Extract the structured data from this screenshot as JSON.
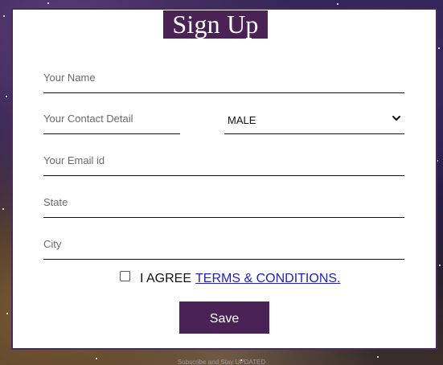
{
  "form": {
    "title": "Sign Up",
    "fields": {
      "name": {
        "placeholder": "Your Name",
        "value": ""
      },
      "contact": {
        "placeholder": "Your Contact Detail",
        "value": ""
      },
      "email": {
        "placeholder": "Your Email id",
        "value": ""
      },
      "state": {
        "placeholder": "State",
        "value": ""
      },
      "city": {
        "placeholder": "City",
        "value": ""
      }
    },
    "gender_select": {
      "selected": "MALE"
    },
    "agreement": {
      "checked": false,
      "label": "I AGREE",
      "link_text": "TERMS & CONDITIONS."
    },
    "save_label": "Save"
  },
  "footer": {
    "text": "Subscribe and Stay UPDATED"
  },
  "colors": {
    "brand": "#4a2255",
    "link": "#2222bb",
    "border": "#4b2a5a"
  },
  "icons": {
    "select_arrow": "chevron-down-icon"
  }
}
